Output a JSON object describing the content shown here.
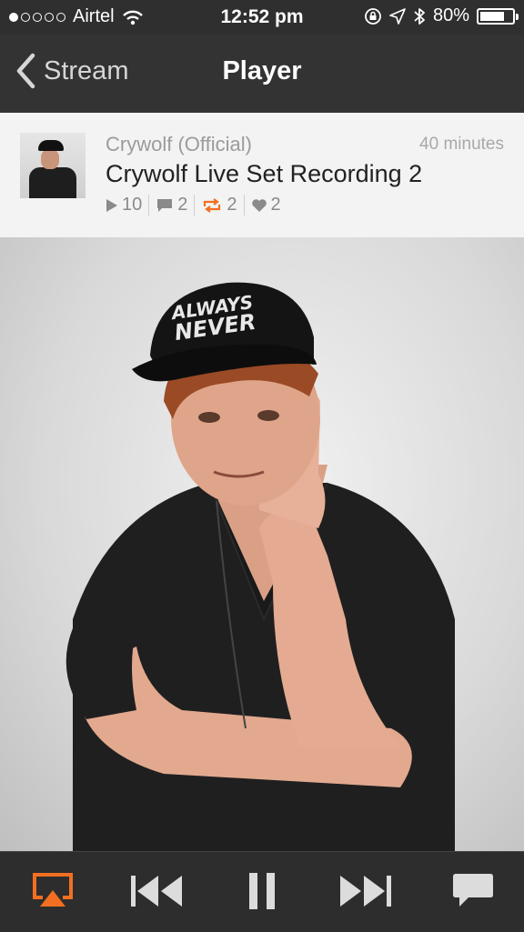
{
  "status_bar": {
    "carrier": "Airtel",
    "time": "12:52 pm",
    "battery_text": "80%",
    "battery_level": 0.8,
    "signal_bars_filled": 1,
    "signal_bars_total": 5
  },
  "nav": {
    "back_label": "Stream",
    "title": "Player"
  },
  "track": {
    "artist": "Crywolf (Official)",
    "duration": "40 minutes",
    "title": "Crywolf Live Set Recording 2",
    "plays": "10",
    "comments": "2",
    "reposts": "2",
    "likes": "2"
  },
  "artwork": {
    "cap_text_line1": "ALWAYS",
    "cap_text_line2": "NEVER"
  },
  "colors": {
    "accent": "#f26f21",
    "navbar": "#333333",
    "player_bar": "#2d2d2d"
  },
  "player_controls": [
    "airplay-icon",
    "previous-track-icon",
    "pause-icon",
    "next-track-icon",
    "comment-icon"
  ]
}
